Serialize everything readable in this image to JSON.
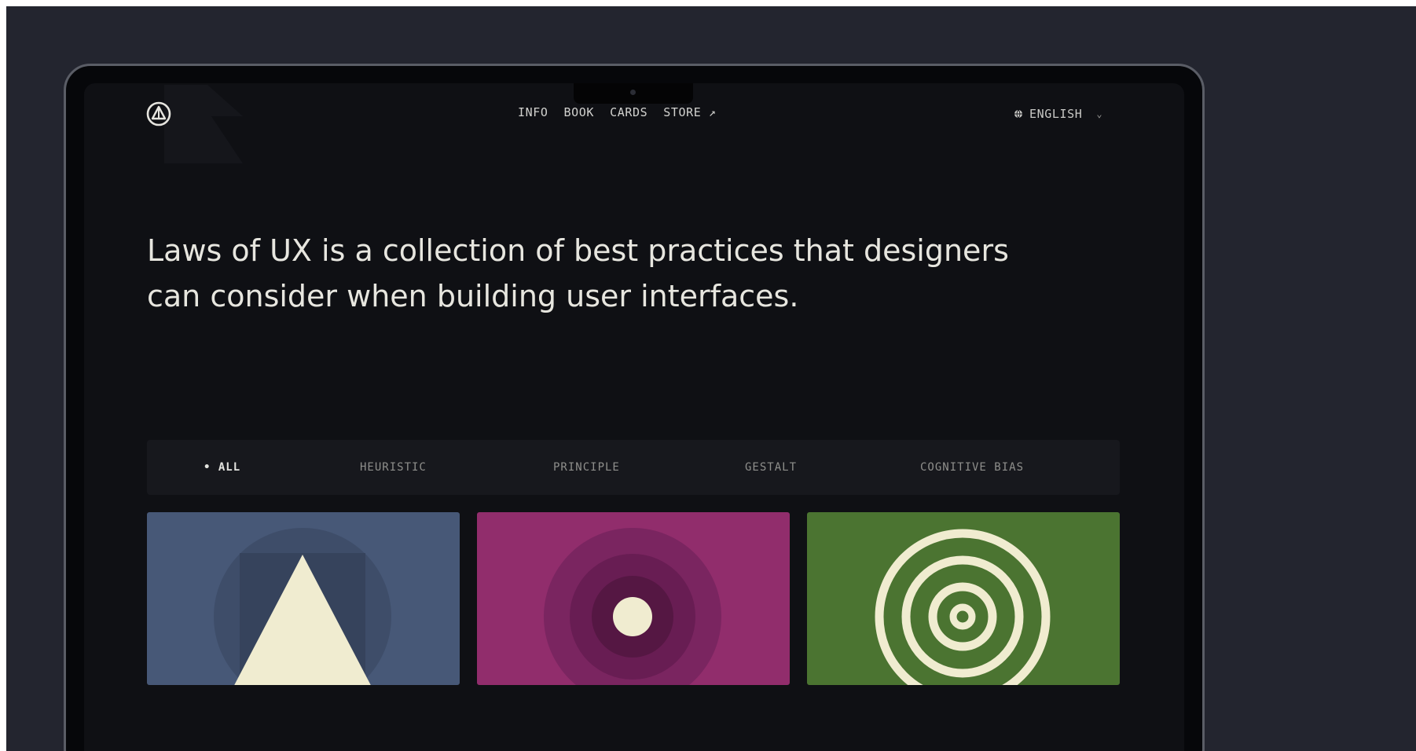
{
  "nav": {
    "items": [
      "INFO",
      "BOOK",
      "CARDS",
      "STORE ↗"
    ]
  },
  "language": {
    "label": "ENGLISH",
    "globe_icon": "globe-icon",
    "chevron_icon": "chevron-down-icon"
  },
  "hero": {
    "line1": "Laws of UX is a collection of best practices that designers",
    "line2": "can consider when building user interfaces."
  },
  "filters": {
    "active_marker": "•",
    "items": [
      "ALL",
      "HEURISTIC",
      "PRINCIPLE",
      "GESTALT",
      "COGNITIVE BIAS"
    ],
    "active_index": 0
  },
  "cards": [
    {
      "color": "#475877",
      "icon": "triangle-in-circle-icon"
    },
    {
      "color": "#912d6c",
      "icon": "concentric-circles-dot-icon"
    },
    {
      "color": "#4b7431",
      "icon": "target-rings-icon"
    }
  ],
  "colors": {
    "background": "#23252f",
    "screen": "#0f1014",
    "text": "#e7e6df",
    "cream": "#f0ecd0"
  }
}
